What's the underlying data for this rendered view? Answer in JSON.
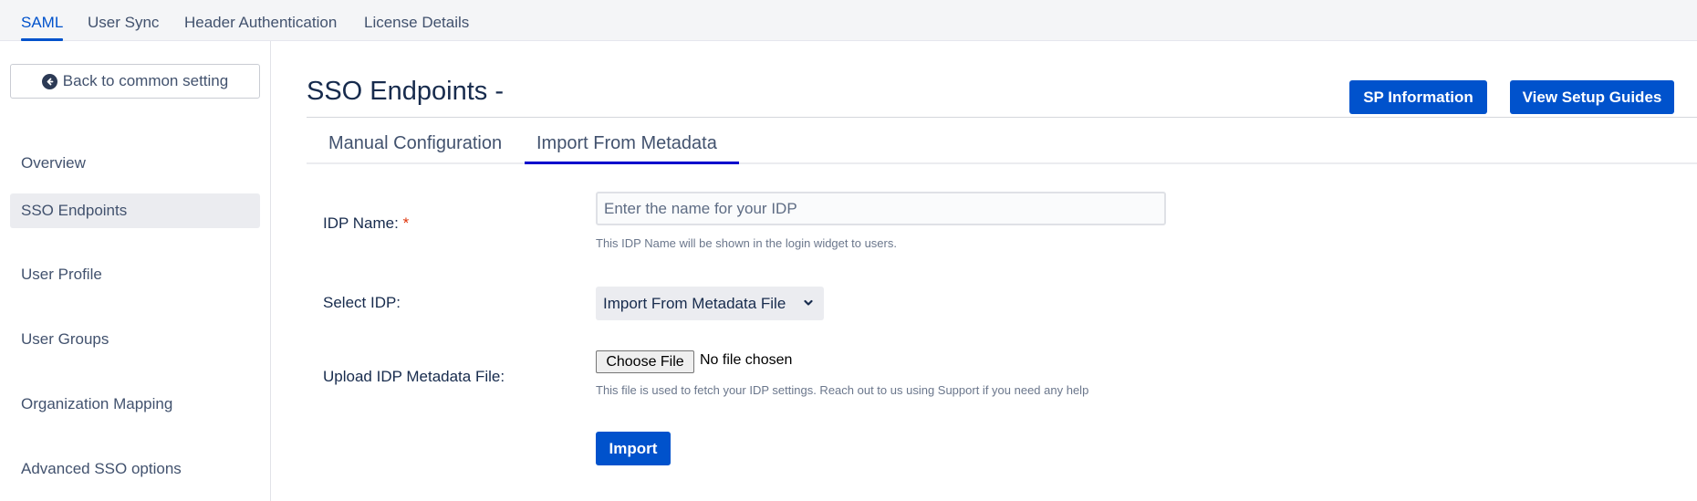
{
  "topnav": {
    "tabs": [
      {
        "label": "SAML",
        "active": true
      },
      {
        "label": "User Sync",
        "active": false
      },
      {
        "label": "Header Authentication",
        "active": false
      },
      {
        "label": "License Details",
        "active": false
      }
    ]
  },
  "sidebar": {
    "back_button": {
      "label": "Back to common setting",
      "icon": "arrow-left-circle-icon"
    },
    "items": [
      {
        "label": "Overview",
        "active": false
      },
      {
        "label": "SSO Endpoints",
        "active": true
      },
      {
        "label": "User Profile",
        "active": false
      },
      {
        "label": "User Groups",
        "active": false
      },
      {
        "label": "Organization Mapping",
        "active": false
      },
      {
        "label": "Advanced SSO options",
        "active": false
      }
    ]
  },
  "main": {
    "title": "SSO Endpoints -",
    "header_buttons": {
      "sp_information": "SP Information",
      "view_setup_guides": "View Setup Guides"
    },
    "subtabs": [
      {
        "label": "Manual Configuration",
        "active": false
      },
      {
        "label": "Import From Metadata",
        "active": true
      }
    ],
    "form": {
      "idp_name": {
        "label": "IDP Name:",
        "required_marker": "*",
        "value": "",
        "placeholder": "Enter the name for your IDP",
        "help": "This IDP Name will be shown in the login widget to users."
      },
      "select_idp": {
        "label": "Select IDP:",
        "selected": "Import From Metadata File"
      },
      "upload": {
        "label": "Upload IDP Metadata File:",
        "choose_button": "Choose File",
        "status": "No file chosen",
        "help": "This file is used to fetch your IDP settings. Reach out to us using Support if you need any help"
      },
      "import_button": "Import"
    }
  },
  "colors": {
    "primary": "#0052cc",
    "active_subtab_underline": "#0000cc",
    "required": "#de350b",
    "text": "#172b4d",
    "muted": "#42526e"
  }
}
